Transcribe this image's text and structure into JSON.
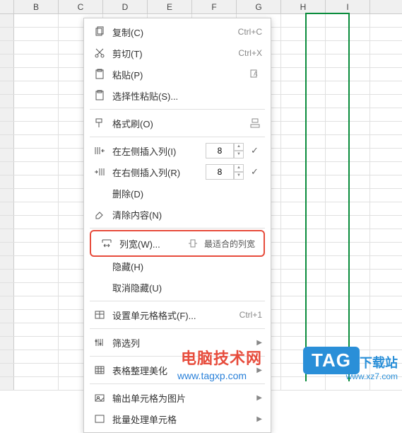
{
  "columns": [
    "B",
    "C",
    "D",
    "E",
    "F",
    "G",
    "H",
    "I"
  ],
  "menu": {
    "copy": {
      "label": "复制(C)",
      "shortcut": "Ctrl+C"
    },
    "cut": {
      "label": "剪切(T)",
      "shortcut": "Ctrl+X"
    },
    "paste": {
      "label": "粘贴(P)"
    },
    "paste_special": {
      "label": "选择性粘贴(S)..."
    },
    "format_painter": {
      "label": "格式刷(O)"
    },
    "insert_left": {
      "label": "在左侧插入列(I)",
      "value": "8"
    },
    "insert_right": {
      "label": "在右侧插入列(R)",
      "value": "8"
    },
    "delete": {
      "label": "删除(D)"
    },
    "clear": {
      "label": "清除内容(N)"
    },
    "col_width": {
      "label": "列宽(W)..."
    },
    "best_fit": {
      "label": "最适合的列宽"
    },
    "hide": {
      "label": "隐藏(H)"
    },
    "unhide": {
      "label": "取消隐藏(U)"
    },
    "format_cells": {
      "label": "设置单元格格式(F)...",
      "shortcut": "Ctrl+1"
    },
    "filter_col": {
      "label": "筛选列"
    },
    "beautify": {
      "label": "表格整理美化"
    },
    "export_img": {
      "label": "输出单元格为图片"
    },
    "batch": {
      "label": "批量处理单元格"
    }
  },
  "watermark": {
    "title": "电脑技术网",
    "url": "www.tagxp.com",
    "badge": "TAG",
    "site2": "下载站",
    "url2": "www.xz7.com"
  }
}
